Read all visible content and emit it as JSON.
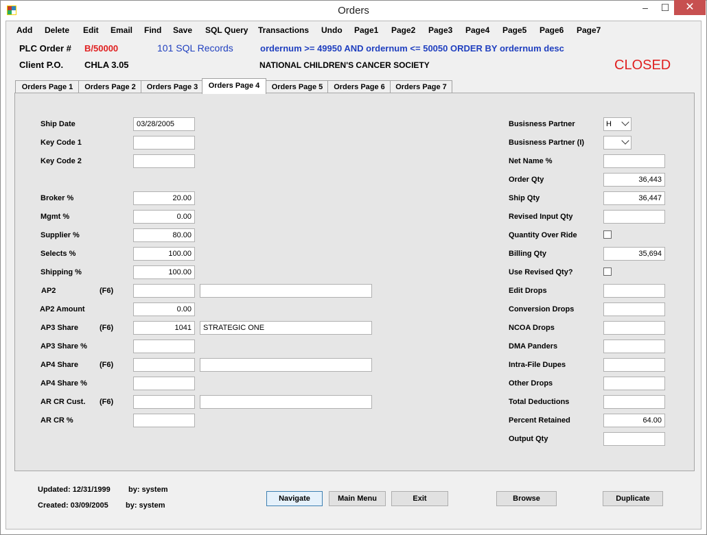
{
  "window": {
    "title": "Orders"
  },
  "menu": [
    "Add",
    "Delete",
    "Edit",
    "Email",
    "Find",
    "Save",
    "SQL Query",
    "Transactions",
    "Undo",
    "Page1",
    "Page2",
    "Page3",
    "Page4",
    "Page5",
    "Page6",
    "Page7"
  ],
  "header": {
    "plc_label": "PLC Order #",
    "plc_value": "B/50000",
    "records": "101 SQL Records",
    "query": "ordernum >= 49950 AND ordernum <= 50050 ORDER BY ordernum desc",
    "client_label": "Client P.O.",
    "client_value": "CHLA 3.05",
    "org_name": "NATIONAL CHILDREN'S CANCER SOCIETY",
    "status": "CLOSED",
    "status_color": "#e02020"
  },
  "tabs": [
    "Orders Page 1",
    "Orders Page 2",
    "Orders Page 3",
    "Orders Page 4",
    "Orders Page 5",
    "Orders Page 6",
    "Orders Page 7"
  ],
  "active_tab": 3,
  "left": {
    "ship_date": {
      "label": "Ship Date",
      "value": "03/28/2005"
    },
    "key_code_1": {
      "label": "Key Code 1",
      "value": ""
    },
    "key_code_2": {
      "label": "Key Code 2",
      "value": ""
    },
    "broker": {
      "label": "Broker %",
      "value": "20.00"
    },
    "mgmt": {
      "label": "Mgmt %",
      "value": "0.00"
    },
    "supplier": {
      "label": "Supplier %",
      "value": "80.00"
    },
    "selects": {
      "label": "Selects %",
      "value": "100.00"
    },
    "shipping": {
      "label": "Shipping %",
      "value": "100.00"
    },
    "ap2": {
      "label": "AP2",
      "hint": "(F6)",
      "value": "",
      "name": ""
    },
    "ap2_amount": {
      "label": "AP2 Amount",
      "value": "0.00"
    },
    "ap3_share": {
      "label": "AP3 Share",
      "hint": "(F6)",
      "value": "1041",
      "name": "STRATEGIC ONE"
    },
    "ap3_share_pct": {
      "label": "AP3 Share  %",
      "value": ""
    },
    "ap4_share": {
      "label": "AP4 Share",
      "hint": "(F6)",
      "value": "",
      "name": ""
    },
    "ap4_share_pct": {
      "label": "AP4 Share  %",
      "value": ""
    },
    "ar_cr_cust": {
      "label": "AR CR Cust.",
      "hint": "(F6)",
      "value": "",
      "name": ""
    },
    "ar_cr_pct": {
      "label": "AR CR %",
      "value": ""
    }
  },
  "right": {
    "business_partner": {
      "label": "Busisness Partner",
      "value": "H"
    },
    "business_partner_i": {
      "label": "Busisness Partner (I)",
      "value": ""
    },
    "net_name": {
      "label": "Net Name %",
      "value": ""
    },
    "order_qty": {
      "label": "Order Qty",
      "value": "36,443"
    },
    "ship_qty": {
      "label": "Ship Qty",
      "value": "36,447"
    },
    "revised_input_qty": {
      "label": "Revised Input Qty",
      "value": ""
    },
    "quantity_override": {
      "label": "Quantity Over Ride"
    },
    "billing_qty": {
      "label": "Billing Qty",
      "value": "35,694"
    },
    "use_revised": {
      "label": "Use Revised Qty?"
    },
    "edit_drops": {
      "label": "Edit Drops",
      "value": ""
    },
    "conversion_drops": {
      "label": "Conversion Drops",
      "value": ""
    },
    "ncoa_drops": {
      "label": "NCOA Drops",
      "value": ""
    },
    "dma_panders": {
      "label": "DMA Panders",
      "value": ""
    },
    "intra_file_dupes": {
      "label": "Intra-File Dupes",
      "value": ""
    },
    "other_drops": {
      "label": "Other Drops",
      "value": ""
    },
    "total_deductions": {
      "label": "Total Deductions",
      "value": ""
    },
    "percent_retained": {
      "label": "Percent Retained",
      "value": "64.00"
    },
    "output_qty": {
      "label": "Output Qty",
      "value": ""
    }
  },
  "footer": {
    "updated": "Updated: 12/31/1999",
    "updated_by": "by: system",
    "created": "Created: 03/09/2005",
    "created_by": "by: system"
  },
  "buttons": {
    "navigate": "Navigate",
    "main_menu": "Main Menu",
    "exit": "Exit",
    "browse": "Browse",
    "duplicate": "Duplicate"
  }
}
